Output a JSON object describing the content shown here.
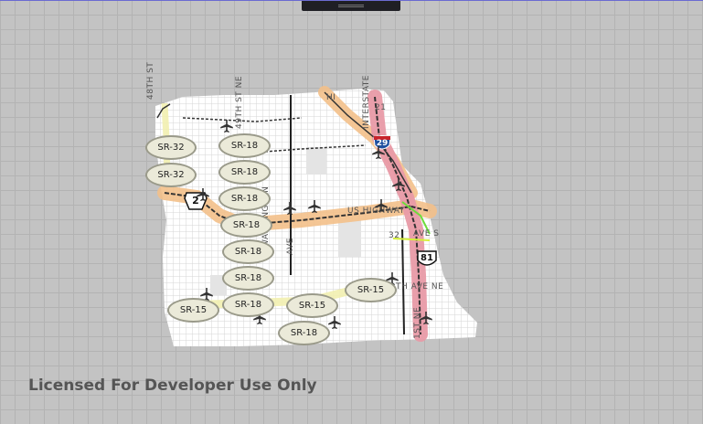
{
  "watermark": "Licensed For Developer Use Only",
  "route_labels": [
    {
      "text": "SR-32"
    },
    {
      "text": "SR-32"
    },
    {
      "text": "SR-18"
    },
    {
      "text": "SR-18"
    },
    {
      "text": "SR-18"
    },
    {
      "text": "SR-18"
    },
    {
      "text": "SR-18"
    },
    {
      "text": "SR-18"
    },
    {
      "text": "SR-18"
    },
    {
      "text": "SR-18"
    },
    {
      "text": "SR-15"
    },
    {
      "text": "SR-15"
    },
    {
      "text": "SR-15"
    }
  ],
  "highway_shields": {
    "state_2": "2",
    "interstate_29": "29",
    "us_81": "81"
  },
  "street_labels": {
    "s48th": "48TH ST",
    "s49th": "49TH ST NE",
    "washington": "WASHINGTON",
    "ave": "AVE",
    "us_highway": "US HIGHWAY",
    "ave_s": "AVE S",
    "s32": "32",
    "th_ave_ne": "TH AVE NE",
    "interstate": "INTERSTATE",
    "s1st": "1ST NE",
    "h29": "HI",
    "s21": "21"
  },
  "colors": {
    "background": "#c3c3c3",
    "land": "#ffffff",
    "highway_orange": "#f3c08a",
    "highway_red": "#e89aa6",
    "interstate_blue": "#1e4fa0",
    "route_fill": "#ebead9"
  }
}
